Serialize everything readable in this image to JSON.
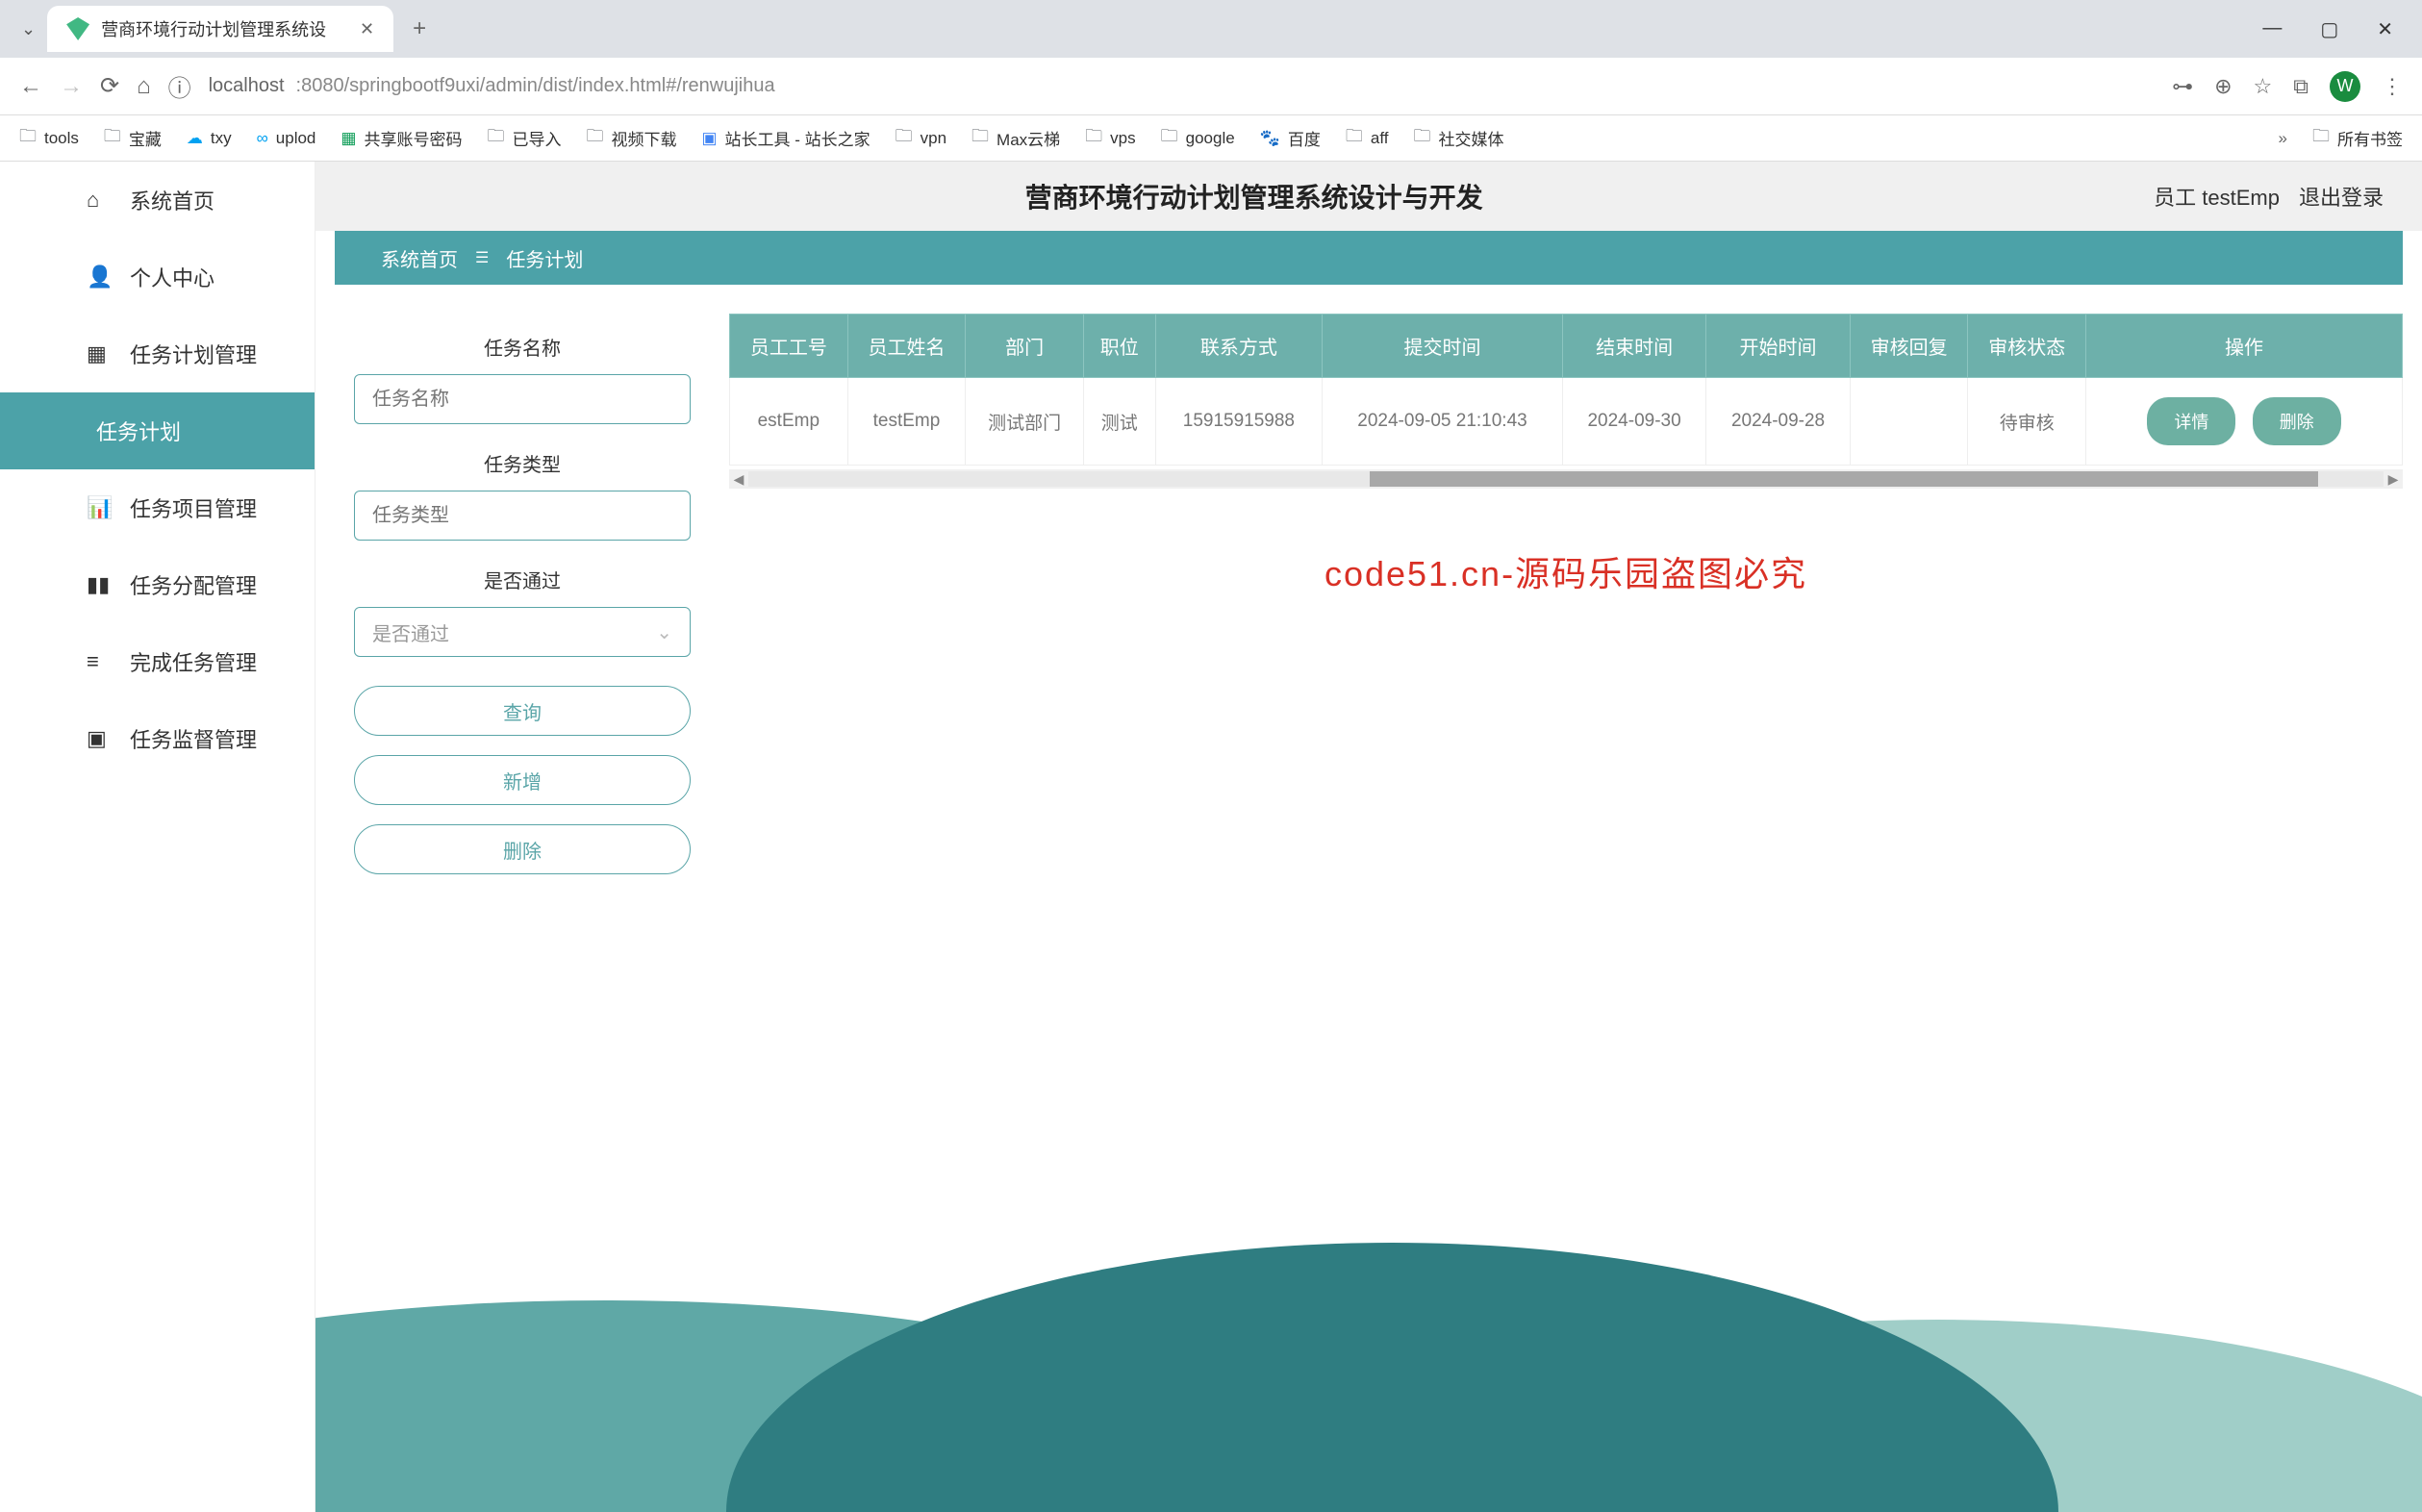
{
  "browser": {
    "tab_title": "营商环境行动计划管理系统设",
    "url_host": "localhost",
    "url_path": ":8080/springbootf9uxi/admin/dist/index.html#/renwujihua",
    "bookmarks": [
      "tools",
      "宝藏",
      "txy",
      "uplod",
      "共享账号密码",
      "已导入",
      "视频下载",
      "站长工具 - 站长之家",
      "vpn",
      "Max云梯",
      "vps",
      "google",
      "百度",
      "aff",
      "社交媒体",
      "所有书签"
    ],
    "profile_letter": "W"
  },
  "sidebar": {
    "items": [
      {
        "icon": "⌂",
        "label": "系统首页"
      },
      {
        "icon": "👤",
        "label": "个人中心"
      },
      {
        "icon": "▦",
        "label": "任务计划管理"
      },
      {
        "icon": "",
        "label": "任务计划",
        "active": true
      },
      {
        "icon": "📊",
        "label": "任务项目管理"
      },
      {
        "icon": "▮",
        "label": "任务分配管理"
      },
      {
        "icon": "≡",
        "label": "完成任务管理"
      },
      {
        "icon": "▣",
        "label": "任务监督管理"
      }
    ]
  },
  "header": {
    "title": "营商环境行动计划管理系统设计与开发",
    "user_label": "员工 testEmp",
    "logout": "退出登录"
  },
  "breadcrumb": {
    "home": "系统首页",
    "current": "任务计划"
  },
  "filters": {
    "name_label": "任务名称",
    "name_placeholder": "任务名称",
    "type_label": "任务类型",
    "type_placeholder": "任务类型",
    "pass_label": "是否通过",
    "pass_placeholder": "是否通过",
    "search_btn": "查询",
    "add_btn": "新增",
    "delete_btn": "删除"
  },
  "table": {
    "headers": [
      "员工工号",
      "员工姓名",
      "部门",
      "职位",
      "联系方式",
      "提交时间",
      "结束时间",
      "开始时间",
      "审核回复",
      "审核状态",
      "操作"
    ],
    "rows": [
      {
        "emp_code": "estEmp",
        "emp_name": "testEmp",
        "dept": "测试部门",
        "position": "测试",
        "contact": "15915915988",
        "submit_time": "2024-09-05 21:10:43",
        "end_time": "2024-09-30",
        "start_time": "2024-09-28",
        "review_reply": "",
        "review_status": "待审核"
      }
    ],
    "action_detail": "详情",
    "action_delete": "删除"
  },
  "red_banner": "code51.cn-源码乐园盗图必究",
  "watermark_text": "code51.cn"
}
